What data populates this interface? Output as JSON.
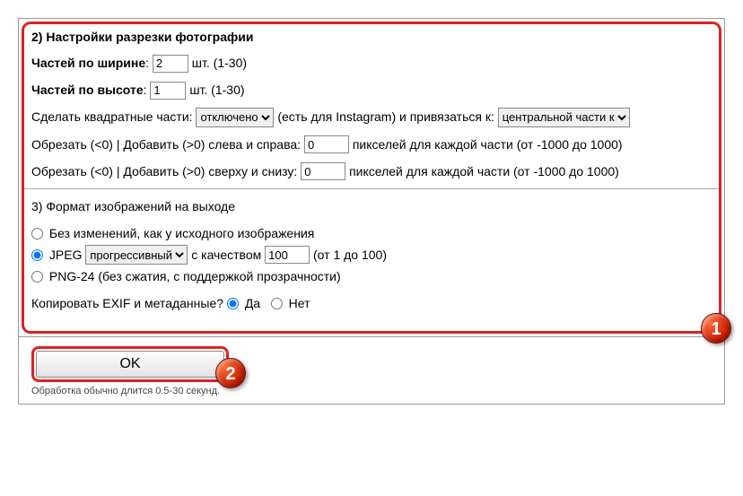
{
  "section2": {
    "title": "2) Настройки разрезки фотографии",
    "width_label": "Частей по ширине",
    "width_value": "2",
    "width_unit": "шт. (1-30)",
    "height_label": "Частей по высоте",
    "height_value": "1",
    "height_unit": "шт. (1-30)",
    "square_label": "Сделать квадратные части:",
    "square_select": "отключено",
    "square_suffix": "(есть для Instagram) и привязаться к:",
    "anchor_select": "центральной части к",
    "crop_lr_label": "Обрезать (<0) | Добавить (>0) слева и справа:",
    "crop_lr_value": "0",
    "crop_lr_suffix": "пикселей для каждой части (от -1000 до 1000)",
    "crop_tb_label": "Обрезать (<0) | Добавить (>0) сверху и снизу:",
    "crop_tb_value": "0",
    "crop_tb_suffix": "пикселей для каждой части (от -1000 до 1000)"
  },
  "section3": {
    "title": "3) Формат изображений на выходе",
    "opt_same": "Без изменений, как у исходного изображения",
    "opt_jpeg": "JPEG",
    "jpeg_select": "прогрессивный",
    "jpeg_quality_label": "с качеством",
    "jpeg_quality_value": "100",
    "jpeg_range": "(от 1 до 100)",
    "opt_png": "PNG-24 (без сжатия, с поддержкой прозрачности)",
    "exif_label": "Копировать EXIF и метаданные?",
    "exif_yes": "Да",
    "exif_no": "Нет"
  },
  "submit": {
    "ok": "OK",
    "note": "Обработка обычно длится 0.5-30 секунд."
  },
  "badges": {
    "one": "1",
    "two": "2"
  }
}
